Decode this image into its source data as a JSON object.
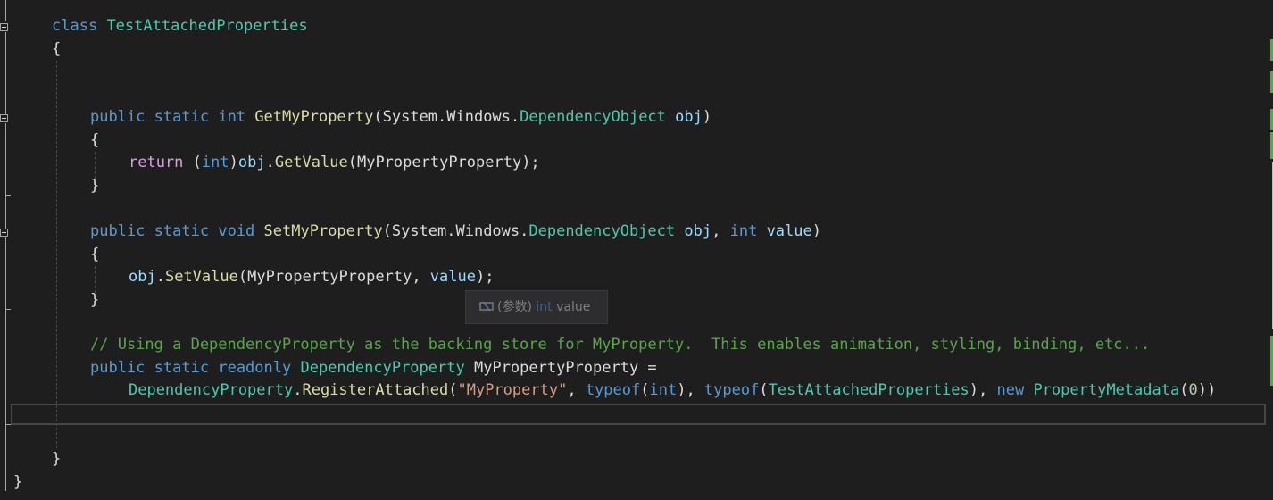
{
  "editor": {
    "lines": [
      {
        "id": "l1",
        "tokens": [
          [
            "kw",
            "class"
          ],
          [
            "pl",
            " "
          ],
          [
            "cls",
            "TestAttachedProperties"
          ]
        ]
      },
      {
        "id": "l2",
        "tokens": [
          [
            "pl",
            "{"
          ]
        ]
      },
      {
        "id": "l5",
        "tokens": [
          [
            "kw",
            "public"
          ],
          [
            "pl",
            " "
          ],
          [
            "kw",
            "static"
          ],
          [
            "pl",
            " "
          ],
          [
            "kw",
            "int"
          ],
          [
            "pl",
            " "
          ],
          [
            "mth",
            "GetMyProperty"
          ],
          [
            "pl",
            "(System.Windows."
          ],
          [
            "cls",
            "DependencyObject"
          ],
          [
            "pl",
            " "
          ],
          [
            "prm",
            "obj"
          ],
          [
            "pl",
            ")"
          ]
        ]
      },
      {
        "id": "l6",
        "tokens": [
          [
            "pl",
            "{"
          ]
        ]
      },
      {
        "id": "l7",
        "tokens": [
          [
            "ctl",
            "return"
          ],
          [
            "pl",
            " ("
          ],
          [
            "kw",
            "int"
          ],
          [
            "pl",
            ")"
          ],
          [
            "prm",
            "obj"
          ],
          [
            "pl",
            "."
          ],
          [
            "mth",
            "GetValue"
          ],
          [
            "pl",
            "(MyPropertyProperty);"
          ]
        ]
      },
      {
        "id": "l8",
        "tokens": [
          [
            "pl",
            "}"
          ]
        ]
      },
      {
        "id": "l10",
        "tokens": [
          [
            "kw",
            "public"
          ],
          [
            "pl",
            " "
          ],
          [
            "kw",
            "static"
          ],
          [
            "pl",
            " "
          ],
          [
            "kw",
            "void"
          ],
          [
            "pl",
            " "
          ],
          [
            "mth",
            "SetMyProperty"
          ],
          [
            "pl",
            "(System.Windows."
          ],
          [
            "cls",
            "DependencyObject"
          ],
          [
            "pl",
            " "
          ],
          [
            "prm",
            "obj"
          ],
          [
            "pl",
            ", "
          ],
          [
            "kw",
            "int"
          ],
          [
            "pl",
            " "
          ],
          [
            "prm",
            "value"
          ],
          [
            "pl",
            ")"
          ]
        ]
      },
      {
        "id": "l11",
        "tokens": [
          [
            "pl",
            "{"
          ]
        ]
      },
      {
        "id": "l12",
        "tokens": [
          [
            "prm",
            "obj"
          ],
          [
            "pl",
            "."
          ],
          [
            "mth",
            "SetValue"
          ],
          [
            "pl",
            "(MyPropertyProperty, "
          ],
          [
            "prm",
            "value"
          ],
          [
            "pl",
            ");"
          ]
        ]
      },
      {
        "id": "l13",
        "tokens": [
          [
            "pl",
            "}"
          ]
        ]
      },
      {
        "id": "l15",
        "tokens": [
          [
            "cmt",
            "// Using a DependencyProperty as the backing store for MyProperty.  This enables animation, styling, binding, etc..."
          ]
        ]
      },
      {
        "id": "l16",
        "tokens": [
          [
            "kw",
            "public"
          ],
          [
            "pl",
            " "
          ],
          [
            "kw",
            "static"
          ],
          [
            "pl",
            " "
          ],
          [
            "kw",
            "readonly"
          ],
          [
            "pl",
            " "
          ],
          [
            "cls",
            "DependencyProperty"
          ],
          [
            "pl",
            " MyPropertyProperty ="
          ]
        ]
      },
      {
        "id": "l17",
        "tokens": [
          [
            "cls",
            "DependencyProperty"
          ],
          [
            "pl",
            "."
          ],
          [
            "mth",
            "RegisterAttached"
          ],
          [
            "pl",
            "("
          ],
          [
            "str",
            "\"MyProperty\""
          ],
          [
            "pl",
            ", "
          ],
          [
            "kw",
            "typeof"
          ],
          [
            "pl",
            "("
          ],
          [
            "kw",
            "int"
          ],
          [
            "pl",
            "), "
          ],
          [
            "kw",
            "typeof"
          ],
          [
            "pl",
            "("
          ],
          [
            "cls",
            "TestAttachedProperties"
          ],
          [
            "pl",
            "), "
          ],
          [
            "kw",
            "new"
          ],
          [
            "pl",
            " "
          ],
          [
            "cls",
            "PropertyMetadata"
          ],
          [
            "pl",
            "("
          ],
          [
            "num",
            "0"
          ],
          [
            "pl",
            "))"
          ]
        ]
      },
      {
        "id": "l20",
        "tokens": [
          [
            "pl",
            "}"
          ]
        ]
      },
      {
        "id": "l21",
        "tokens": [
          [
            "pl",
            "}"
          ]
        ]
      }
    ]
  },
  "tooltip": {
    "icon": "parameter-icon",
    "prefix": "(参数) ",
    "type": "int",
    "name": " value"
  },
  "colors": {
    "background": "#1e1e1e",
    "keyword": "#569cd6",
    "control": "#d8a0df",
    "class": "#4ec9b0",
    "method": "#dcdcaa",
    "parameter": "#9cdcfe",
    "string": "#d69d85",
    "number": "#b5cea8",
    "comment": "#57a64a",
    "change_saved": "#57a64a",
    "change_unsaved": "#d7ba7d"
  }
}
